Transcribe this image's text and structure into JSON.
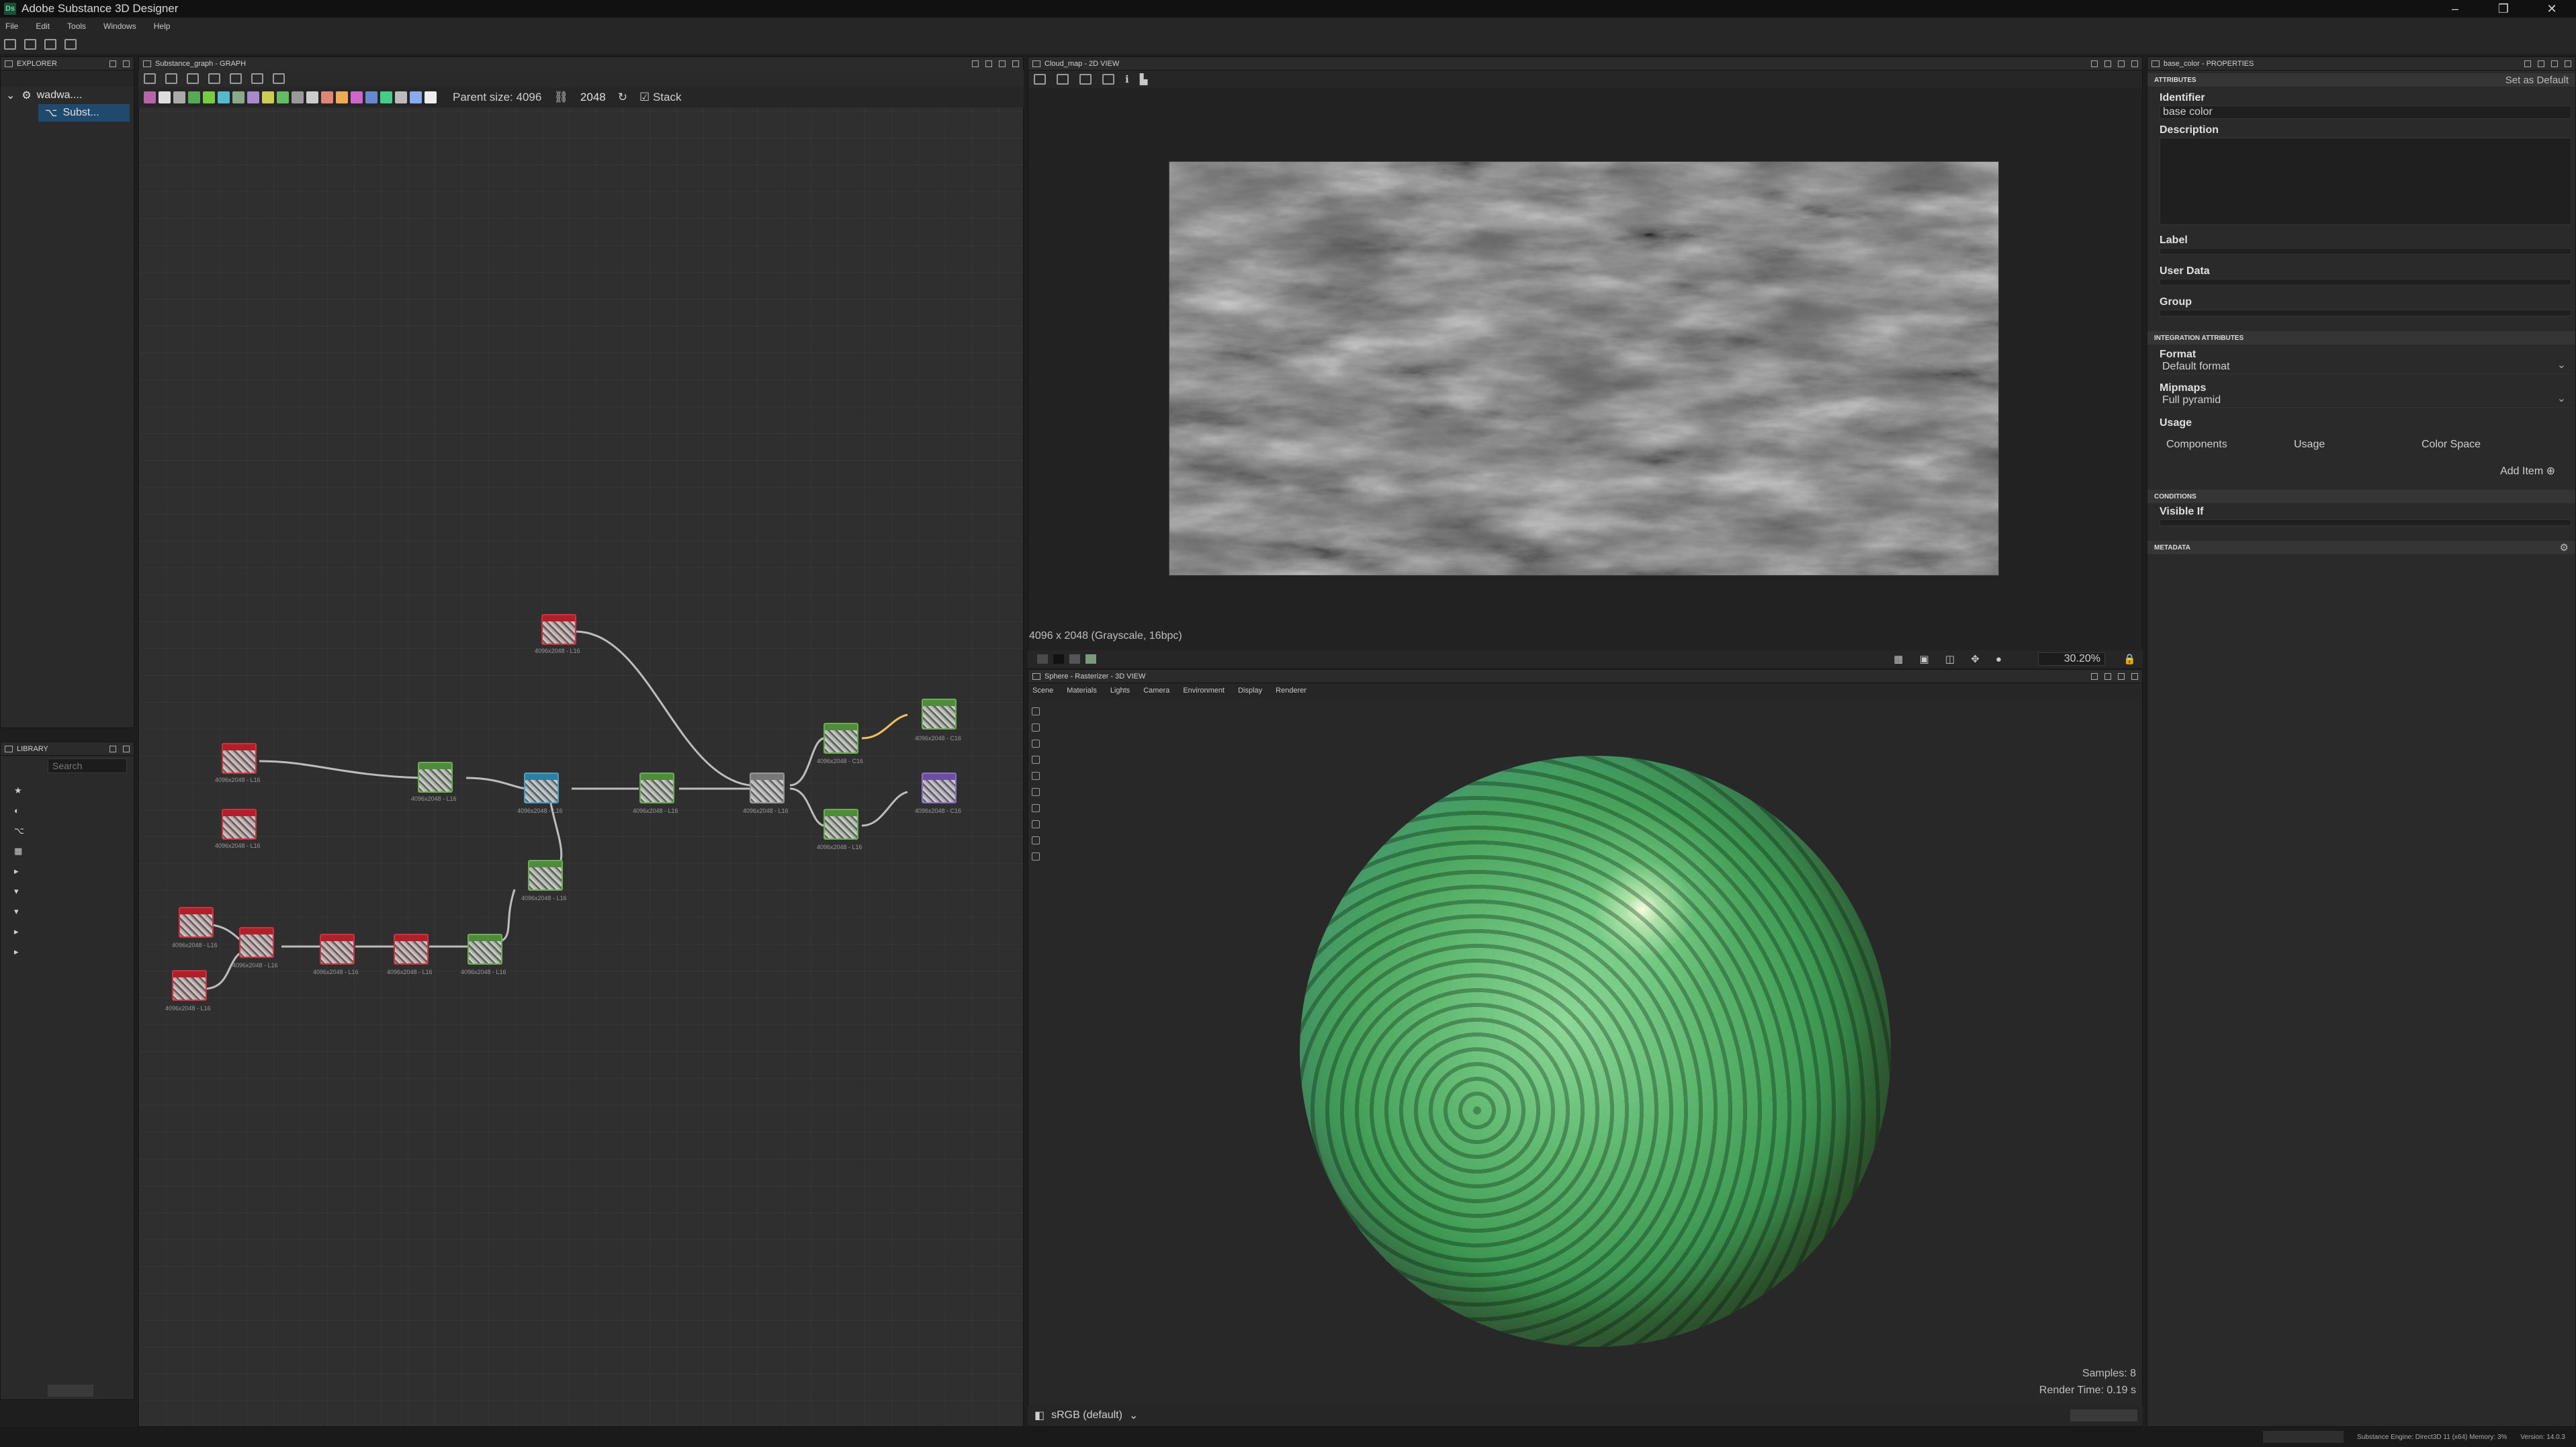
{
  "app": {
    "title": "Adobe Substance 3D Designer",
    "logo": "Ds"
  },
  "menu": [
    "File",
    "Edit",
    "Tools",
    "Windows",
    "Help"
  ],
  "explorer": {
    "header": "EXPLORER",
    "items": [
      {
        "label": "wadwa...."
      },
      {
        "label": "Subst..."
      }
    ]
  },
  "library": {
    "header": "LIBRARY",
    "search_placeholder": "Search"
  },
  "graph": {
    "header": "Substance_graph - GRAPH",
    "parent_size_label": "Parent size: 4096",
    "size_value": "2048",
    "stack_label": "Stack",
    "nodes": [
      {
        "label": "4096x2048 - L16"
      },
      {
        "label": "4096x2048 - L16"
      },
      {
        "label": "4096x2048 - L16"
      },
      {
        "label": "4096x2048 - L16"
      },
      {
        "label": "4096x2048 - L16"
      },
      {
        "label": "4096x2048 - L16"
      },
      {
        "label": "4096x2048 - L16"
      },
      {
        "label": "4096x2048 - L16"
      },
      {
        "label": "4096x2048 - C16"
      },
      {
        "label": "4096x2048 - C16"
      },
      {
        "label": "4096x2048 - L16"
      },
      {
        "label": "4096x2048 - C16"
      },
      {
        "label": "4096x2048 - L16"
      },
      {
        "label": "4096x2048 - L16"
      },
      {
        "label": "4096x2048 - L16"
      },
      {
        "label": "4096x2048 - L16"
      },
      {
        "label": "4096x2048 - L16"
      },
      {
        "label": "4096x2048 - L16"
      },
      {
        "label": "4096x2048 - L16"
      },
      {
        "label": "4096x2048 - L16"
      }
    ]
  },
  "view2d": {
    "header": "Cloud_map - 2D VIEW",
    "info": "4096 x 2048 (Grayscale, 16bpc)",
    "zoom": "30.20%"
  },
  "view3d": {
    "header": "Sphere - Rasterizer - 3D VIEW",
    "tabs": [
      "Scene",
      "Materials",
      "Lights",
      "Camera",
      "Environment",
      "Display",
      "Renderer"
    ],
    "samples": "Samples: 8",
    "render_time": "Render Time: 0.19 s",
    "colorspace": "sRGB (default)"
  },
  "properties": {
    "header": "base_color - PROPERTIES",
    "attributes_section": "ATTRIBUTES",
    "set_default": "Set as Default",
    "identifier_label": "Identifier",
    "identifier_value": "base color",
    "description_label": "Description",
    "label_label": "Label",
    "userdata_label": "User Data",
    "group_label": "Group",
    "integration_section": "INTEGRATION ATTRIBUTES",
    "format_label": "Format",
    "format_value": "Default format",
    "mipmaps_label": "Mipmaps",
    "mipmaps_value": "Full pyramid",
    "usage_label": "Usage",
    "usage_cols": [
      "Components",
      "Usage",
      "Color Space"
    ],
    "add_item": "Add Item",
    "conditions_section": "CONDITIONS",
    "visible_if_label": "Visible If",
    "metadata_section": "METADATA"
  },
  "status": {
    "engine": "Substance Engine: Direct3D 11 (x64)  Memory: 3%",
    "version": "Version: 14.0.3"
  },
  "colors": {
    "accent": "#1f4a6e",
    "node_red": "#b0202a",
    "node_green": "#4e8c3c"
  }
}
